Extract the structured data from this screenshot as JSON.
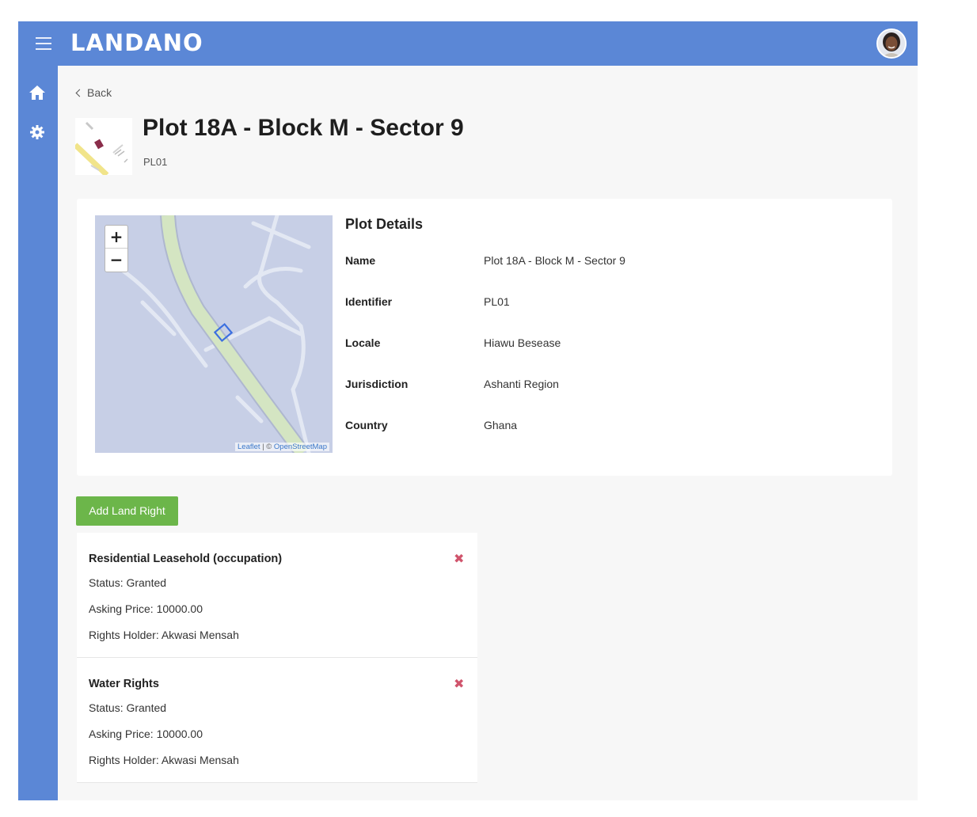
{
  "app": {
    "brand": "LANDANO"
  },
  "nav": {
    "back_label": "Back"
  },
  "plot": {
    "title": "Plot 18A - Block M - Sector 9",
    "code": "PL01"
  },
  "details": {
    "heading": "Plot Details",
    "rows": [
      {
        "label": "Name",
        "value": "Plot 18A - Block M - Sector 9"
      },
      {
        "label": "Identifier",
        "value": "PL01"
      },
      {
        "label": "Locale",
        "value": "Hiawu Besease"
      },
      {
        "label": "Jurisdiction",
        "value": "Ashanti Region"
      },
      {
        "label": "Country",
        "value": "Ghana"
      }
    ]
  },
  "map": {
    "zoom_in": "+",
    "zoom_out": "−",
    "attribution_leaflet": "Leaflet",
    "attribution_sep": " | © ",
    "attribution_osm": "OpenStreetMap"
  },
  "actions": {
    "add_land_right": "Add Land Right"
  },
  "land_rights": [
    {
      "title": "Residential Leasehold (occupation)",
      "status": "Status: Granted",
      "asking_price": "Asking Price: 10000.00",
      "rights_holder": "Rights Holder: Akwasi Mensah",
      "delete_icon": "✖"
    },
    {
      "title": "Water Rights",
      "status": "Status: Granted",
      "asking_price": "Asking Price: 10000.00",
      "rights_holder": "Rights Holder: Akwasi Mensah",
      "delete_icon": "✖"
    }
  ],
  "colors": {
    "primary": "#5b87d6",
    "success": "#6cb64a",
    "danger": "#d0546c"
  }
}
